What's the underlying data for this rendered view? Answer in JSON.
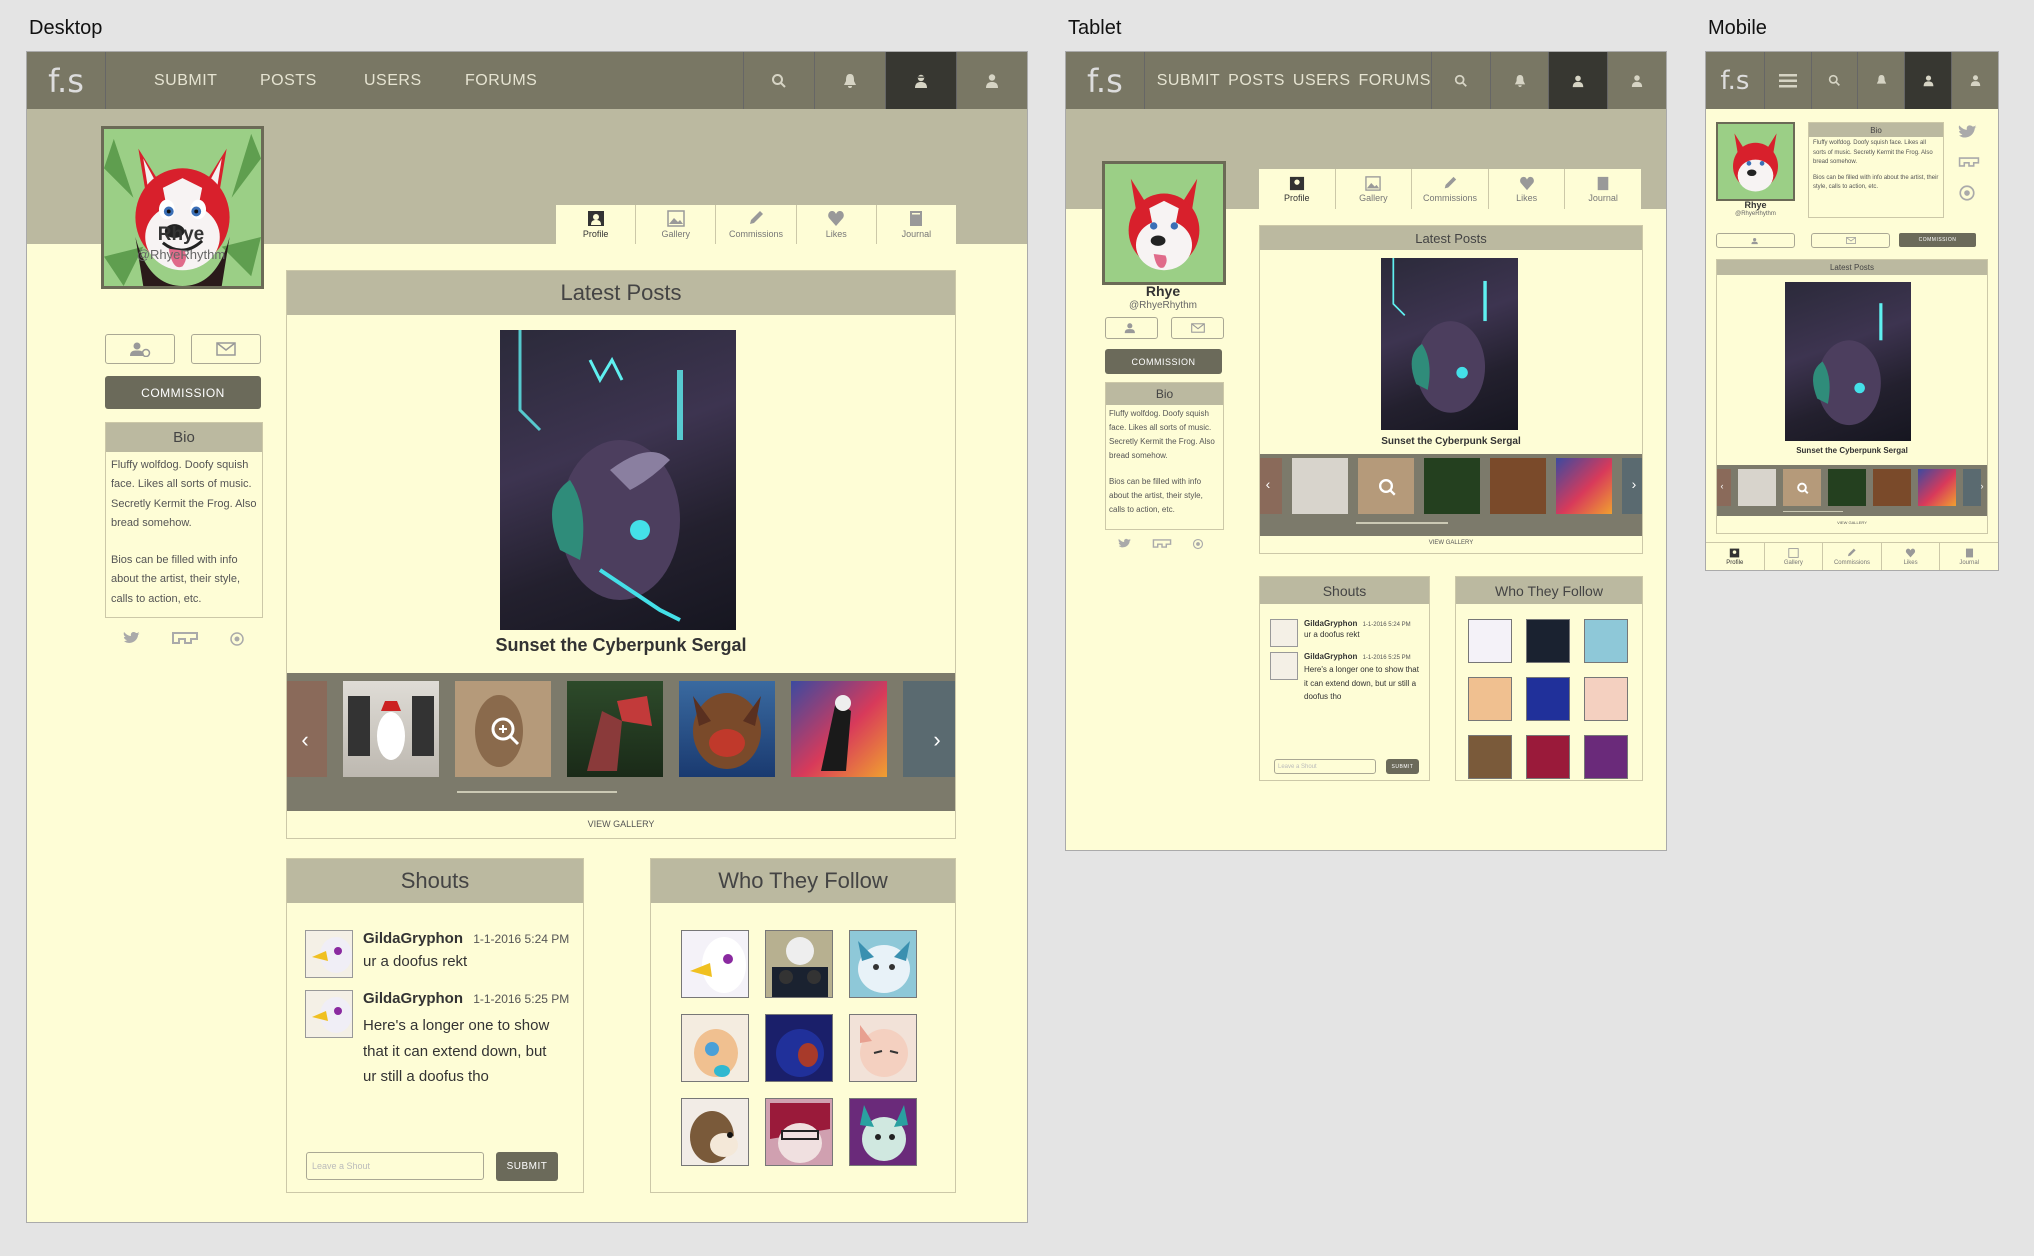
{
  "labels": {
    "desktop": "Desktop",
    "tablet": "Tablet",
    "mobile": "Mobile"
  },
  "logo": "f.s",
  "nav": {
    "links": [
      "SUBMIT",
      "POSTS",
      "USERS",
      "FORUMS"
    ]
  },
  "icons": {
    "nav": [
      "search-icon",
      "bell-icon",
      "user-silhouette-icon",
      "person-icon"
    ],
    "hamburger": "hamburger-icon"
  },
  "tabs": [
    "Profile",
    "Gallery",
    "Commissions",
    "Likes",
    "Journal"
  ],
  "profile": {
    "name": "Rhye",
    "handle": "@RhyeRhythm",
    "commission_label": "COMMISSION",
    "bio_title": "Bio",
    "bio_p1": "Fluffy wolfdog. Doofy squish face. Likes all sorts of music. Secretly Kermit the Frog. Also bread somehow.",
    "bio_p2": "Bios can be filled with info about the artist, their style, calls to action, etc."
  },
  "latest": {
    "title": "Latest Posts",
    "caption": "Sunset the Cyberpunk Sergal",
    "view_gallery": "VIEW GALLERY"
  },
  "shouts": {
    "title": "Shouts",
    "items": [
      {
        "user": "GildaGryphon",
        "time": "1-1-2016 5:24 PM",
        "text": "ur a doofus rekt"
      },
      {
        "user": "GildaGryphon",
        "time": "1-1-2016 5:25 PM",
        "text": "Here's a longer one to show that it can extend down, but ur still a doofus tho"
      }
    ],
    "placeholder": "Leave a Shout",
    "submit": "SUBMIT"
  },
  "follow": {
    "title": "Who They Follow"
  },
  "colors": {
    "nav": "#797764",
    "banner": "#bbb9a0",
    "page": "#fefdd6",
    "button": "#6b6a5a",
    "active_icon": "#373731"
  }
}
